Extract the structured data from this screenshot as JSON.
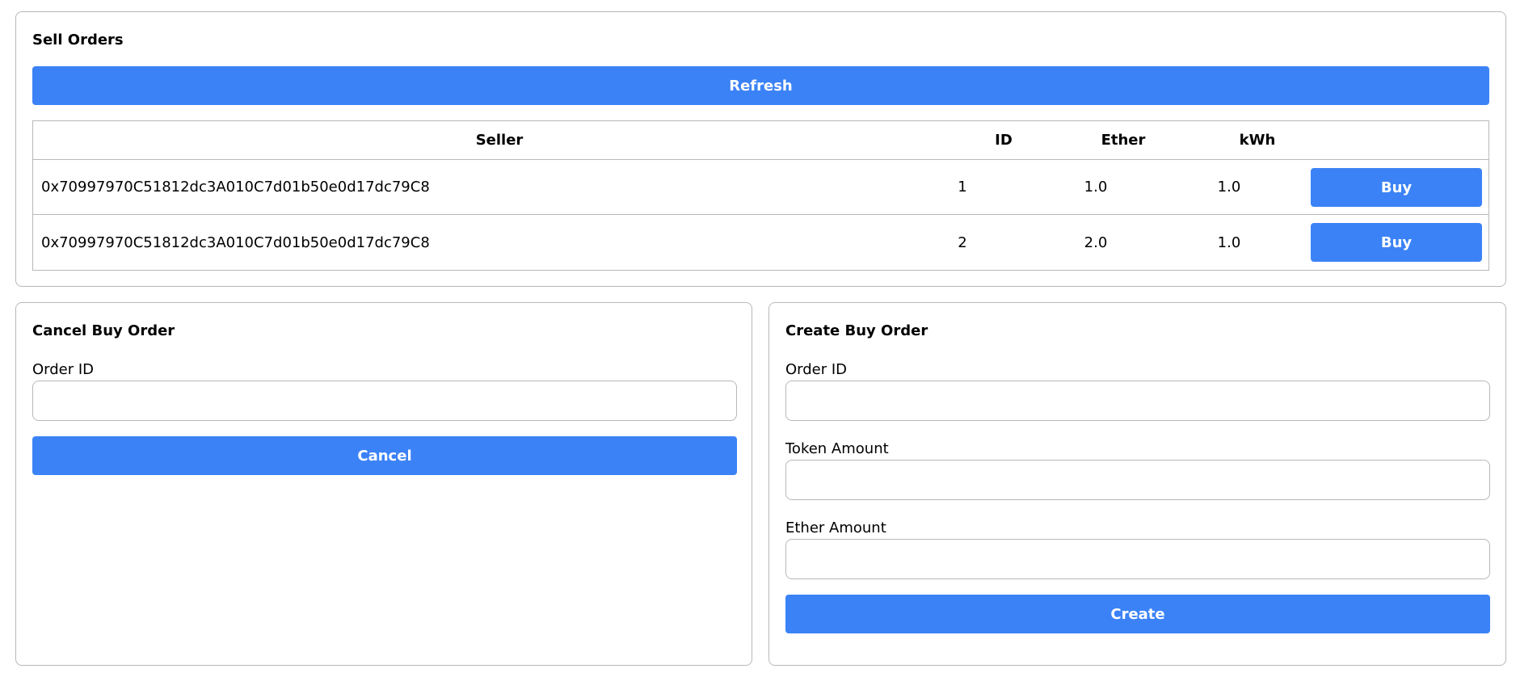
{
  "sell_orders": {
    "title": "Sell Orders",
    "refresh_label": "Refresh",
    "columns": {
      "seller": "Seller",
      "id": "ID",
      "ether": "Ether",
      "kwh": "kWh"
    },
    "rows": [
      {
        "seller": "0x70997970C51812dc3A010C7d01b50e0d17dc79C8",
        "id": "1",
        "ether": "1.0",
        "kwh": "1.0",
        "action_label": "Buy"
      },
      {
        "seller": "0x70997970C51812dc3A010C7d01b50e0d17dc79C8",
        "id": "2",
        "ether": "2.0",
        "kwh": "1.0",
        "action_label": "Buy"
      }
    ]
  },
  "cancel_buy_order": {
    "title": "Cancel Buy Order",
    "order_id_label": "Order ID",
    "order_id_value": "",
    "button_label": "Cancel"
  },
  "create_buy_order": {
    "title": "Create Buy Order",
    "order_id_label": "Order ID",
    "order_id_value": "",
    "token_amount_label": "Token Amount",
    "token_amount_value": "",
    "ether_amount_label": "Ether Amount",
    "ether_amount_value": "",
    "button_label": "Create"
  },
  "colors": {
    "accent": "#3b82f6",
    "border": "#b8b8b8"
  }
}
